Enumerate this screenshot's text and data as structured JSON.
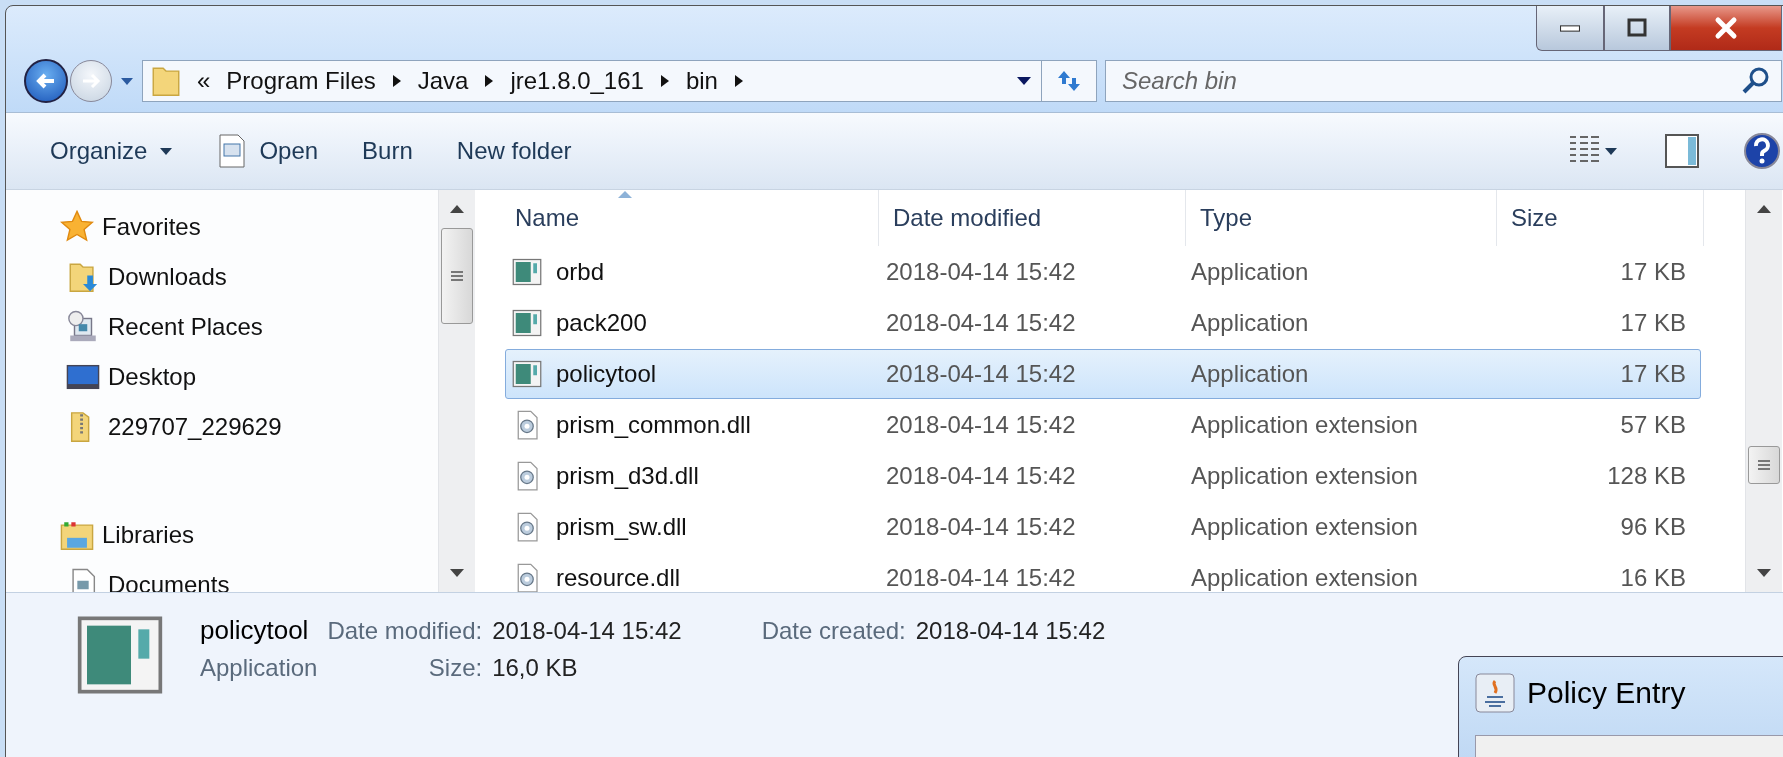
{
  "address": {
    "prefix": "«",
    "path": [
      "Program Files",
      "Java",
      "jre1.8.0_161",
      "bin"
    ]
  },
  "search": {
    "placeholder": "Search bin"
  },
  "toolbar": [
    {
      "label": "Organize",
      "kind": "menu"
    },
    {
      "label": "Open",
      "kind": "open"
    },
    {
      "label": "Burn",
      "kind": "plain"
    },
    {
      "label": "New folder",
      "kind": "plain"
    }
  ],
  "nav_pane": [
    {
      "label": "Favorites",
      "kind": "favorites",
      "children": [
        {
          "label": "Downloads",
          "kind": "downloads"
        },
        {
          "label": "Recent Places",
          "kind": "recent"
        },
        {
          "label": "Desktop",
          "kind": "desktop"
        },
        {
          "label": "229707_229629",
          "kind": "folder"
        }
      ]
    },
    {
      "label": "Libraries",
      "kind": "libraries",
      "children": [
        {
          "label": "Documents",
          "kind": "documents"
        }
      ]
    }
  ],
  "table": {
    "columns": [
      {
        "label": "Name",
        "sorted": true
      },
      {
        "label": "Date modified",
        "sorted": false
      },
      {
        "label": "Type",
        "sorted": false
      },
      {
        "label": "Size",
        "sorted": false
      }
    ],
    "rows": [
      {
        "name": "orbd",
        "date": "2018-04-14 15:42",
        "type": "Application",
        "size": "17 KB",
        "kind": "app",
        "selected": false
      },
      {
        "name": "pack200",
        "date": "2018-04-14 15:42",
        "type": "Application",
        "size": "17 KB",
        "kind": "app",
        "selected": false
      },
      {
        "name": "policytool",
        "date": "2018-04-14 15:42",
        "type": "Application",
        "size": "17 KB",
        "kind": "app",
        "selected": true
      },
      {
        "name": "prism_common.dll",
        "date": "2018-04-14 15:42",
        "type": "Application extension",
        "size": "57 KB",
        "kind": "dll",
        "selected": false
      },
      {
        "name": "prism_d3d.dll",
        "date": "2018-04-14 15:42",
        "type": "Application extension",
        "size": "128 KB",
        "kind": "dll",
        "selected": false
      },
      {
        "name": "prism_sw.dll",
        "date": "2018-04-14 15:42",
        "type": "Application extension",
        "size": "96 KB",
        "kind": "dll",
        "selected": false
      },
      {
        "name": "resource.dll",
        "date": "2018-04-14 15:42",
        "type": "Application extension",
        "size": "16 KB",
        "kind": "dll",
        "selected": false
      }
    ]
  },
  "details": {
    "name": "policytool",
    "type": "Application",
    "fields": [
      {
        "label": "Date modified:",
        "value": "2018-04-14 15:42"
      },
      {
        "label": "Date created:",
        "value": "2018-04-14 15:42"
      },
      {
        "label": "Size:",
        "value": "16,0 KB"
      }
    ]
  },
  "dialog": {
    "title": "Policy Entry"
  }
}
